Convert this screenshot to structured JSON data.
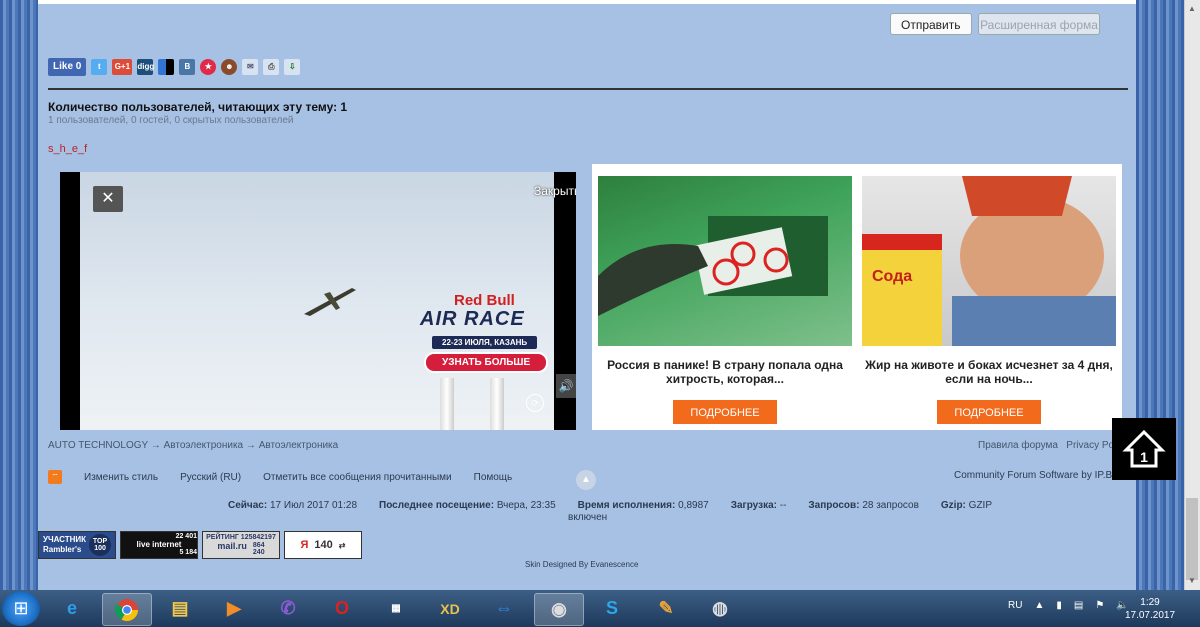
{
  "form": {
    "send_label": "Отправить",
    "advanced_label": "Расширенная форма"
  },
  "share": {
    "fb_like": "Like 0",
    "icons": [
      "twitter-icon",
      "google-plus-icon",
      "digg-icon",
      "delicious-icon",
      "vk-icon",
      "star-icon",
      "odnoklassniki-icon",
      "email-icon",
      "print-icon",
      "download-icon"
    ]
  },
  "readers": {
    "title": "Количество пользователей, читающих эту тему: 1",
    "subtitle": "1 пользователей, 0 гостей, 0 скрытых пользователей",
    "user": "s_h_e_f"
  },
  "video_ad": {
    "close_label": "Закрыть",
    "brand": "Red Bull",
    "event": "AIR RACE",
    "date": "22-23 ИЮЛЯ, КАЗАНЬ",
    "cta": "УЗНАТЬ БОЛЬШЕ"
  },
  "ads": [
    {
      "text": "Россия в панике! В страну попала одна хитрость, которая...",
      "button": "ПОДРОБНЕЕ"
    },
    {
      "text": "Жир на животе и боках исчезнет за 4 дня, если на ночь...",
      "button": "ПОДРОБНЕЕ",
      "product_label": "Сода"
    }
  ],
  "breadcrumb": {
    "a": "AUTO TECHNOLOGY",
    "sep": "→",
    "b": "Автоэлектроника",
    "c": "Автоэлектроника"
  },
  "footer_links": {
    "rules": "Правила форума",
    "privacy": "Privacy Po"
  },
  "footer_bar": {
    "change_style": "Изменить стиль",
    "language": "Русский (RU)",
    "mark_read": "Отметить все сообщения прочитанными",
    "help": "Помощь",
    "software": "Community Forum Software by IP.Bo"
  },
  "stats": {
    "now_label": "Сейчас:",
    "now_value": "17 Июл 2017 01:28",
    "last_visit_label": "Последнее посещение:",
    "last_visit_value": "Вчера, 23:35",
    "exec_label": "Время исполнения:",
    "exec_value": "0,8987",
    "exec_sub": "включен",
    "load_label": "Загрузка:",
    "load_value": "--",
    "queries_label": "Запросов:",
    "queries_value": "28 запросов",
    "gzip_label": "Gzip:",
    "gzip_value": "GZIP"
  },
  "counters": {
    "rambler_line1": "УЧАСТНИК",
    "rambler_line2": "Rambler's",
    "rambler_top": "TOP 100",
    "li_nums1": "22 401",
    "li_label": "live internet",
    "li_nums2": "5 184",
    "mail_rating": "РЕЙТИНГ",
    "mail_num1": "125842197",
    "mail_num2": "864",
    "mail_num3": "240",
    "mail_brand": "mail.ru",
    "ya_letter": "Я",
    "ya_num": "140"
  },
  "skin": "Skin Designed By Evanescence",
  "taskbar": {
    "lang": "RU",
    "time": "1:29",
    "date": "17.07.2017",
    "apps": [
      "ie-icon",
      "chrome-icon",
      "explorer-icon",
      "media-player-icon",
      "viber-icon",
      "opera-icon",
      "calculator-app-icon",
      "xd-icon",
      "teamviewer-icon",
      "webcam-icon",
      "skype-icon",
      "paint-icon",
      "speaker-app-icon"
    ]
  }
}
